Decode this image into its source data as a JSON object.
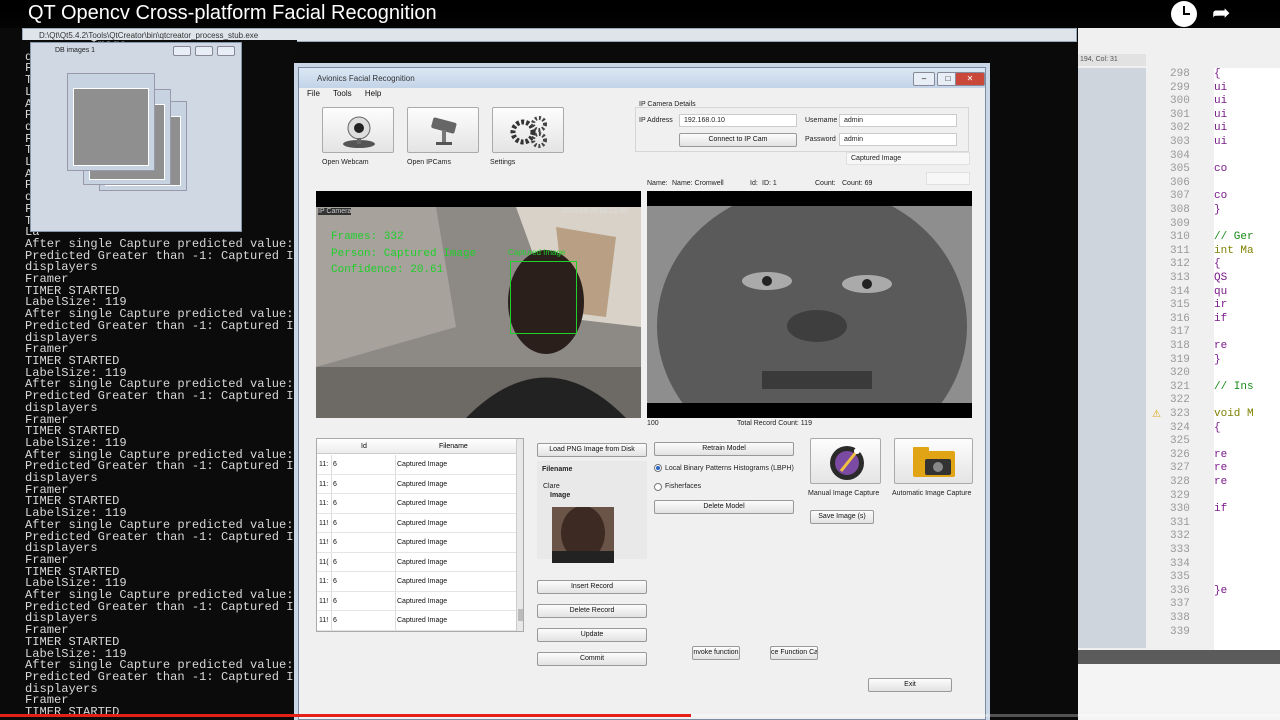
{
  "video": {
    "title": "QT Opencv Cross-platform Facial Recognition"
  },
  "console": {
    "path": "D:\\Qt\\Qt5.4.2\\Tools\\QtCreator\\bin\\qtcreator_process_stub.exe",
    "lines": [
      "",
      "         Image",
      "di",
      "Fr",
      "TI",
      "La",
      "Af           value: 114",
      "Pr          Captured Image",
      "di",
      "Fr",
      "TI",
      "La",
      "Af           value: 114",
      "Pr          Captured Image",
      "di",
      "Fr",
      "TI",
      "La",
      "After single Capture predicted value: 115",
      "Predicted Greater than -1: Captured Image",
      "displayers",
      "Framer",
      "TIMER STARTED",
      "LabelSize: 119",
      "After single Capture predicted value: 114",
      "Predicted Greater than -1: Captured Image",
      "displayers",
      "Framer",
      "TIMER STARTED",
      "LabelSize: 119",
      "After single Capture predicted value: 114",
      "Predicted Greater than -1: Captured Image",
      "displayers",
      "Framer",
      "TIMER STARTED",
      "LabelSize: 119",
      "After single Capture predicted value: 113",
      "Predicted Greater than -1: Captured Image",
      "displayers",
      "Framer",
      "TIMER STARTED",
      "LabelSize: 119",
      "After single Capture predicted value: 113",
      "Predicted Greater than -1: Captured Image",
      "displayers",
      "Framer",
      "TIMER STARTED",
      "LabelSize: 119",
      "After single Capture predicted value: 114",
      "Predicted Greater than -1: Captured Image",
      "displayers",
      "Framer",
      "TIMER STARTED",
      "LabelSize: 119",
      "After single Capture predicted value: 114",
      "Predicted Greater than -1: Captured Image",
      "displayers",
      "Framer",
      "TIMER STARTED"
    ]
  },
  "db_window": {
    "title": "DB images 1"
  },
  "app": {
    "title": "Avionics Facial Recognition",
    "menu": [
      "File",
      "Tools",
      "Help"
    ],
    "toolbar": {
      "webcam": "Open Webcam",
      "ipcam": "Open IPCams",
      "settings": "Settings"
    },
    "ip": {
      "group": "IP Camera Details",
      "address_label": "IP Address",
      "address": "192.168.0.10",
      "username_label": "Username",
      "username": "admin",
      "password_label": "Password",
      "password": "admin",
      "connect": "Connect to IP Cam",
      "captured": "Captured Image"
    },
    "info": {
      "name_label": "Name:",
      "name": "Name: Cromwell",
      "id_label": "Id:",
      "id": "ID: 1",
      "count_label": "Count:",
      "count": "Count: 69"
    },
    "cam_overlay": {
      "label": "IP Camera",
      "timestamp": "2015-09-23 06:12:30",
      "frames": "Frames: 332",
      "person": "Person: Captured Image",
      "confidence": "Confidence: 20.61",
      "box_label": "Captured Image"
    },
    "below": {
      "left_value": "100",
      "total": "Total Record Count: 119"
    },
    "table": {
      "headers": [
        "Id",
        "Filename"
      ],
      "rows": [
        {
          "no": "11:",
          "id": "6",
          "file": "Captured Image"
        },
        {
          "no": "11:",
          "id": "6",
          "file": "Captured Image"
        },
        {
          "no": "11:",
          "id": "6",
          "file": "Captured Image"
        },
        {
          "no": "11!",
          "id": "6",
          "file": "Captured Image"
        },
        {
          "no": "11!",
          "id": "6",
          "file": "Captured Image"
        },
        {
          "no": "11(",
          "id": "6",
          "file": "Captured Image"
        },
        {
          "no": "11:",
          "id": "6",
          "file": "Captured Image"
        },
        {
          "no": "11!",
          "id": "6",
          "file": "Captured Image"
        },
        {
          "no": "11!",
          "id": "6",
          "file": "Captured Image"
        }
      ]
    },
    "buttons": {
      "load": "Load PNG Image from Disk",
      "insert": "Insert Record",
      "delete": "Delete Record",
      "update": "Update",
      "commit": "Commit",
      "retrain": "Retrain Model",
      "delete_model": "Delete Model",
      "save": "Save Image (s)",
      "invoke1": "nvoke function",
      "invoke2": "ce Function Ca",
      "exit": "Exit"
    },
    "detail": {
      "filename_label": "Filename",
      "filename": "Clare",
      "image_label": "Image"
    },
    "radios": {
      "lbph": "Local Binary Patterns Histograms (LBPH)",
      "fisher": "Fisherfaces"
    },
    "captures": {
      "manual": "Manual Image Capture",
      "auto": "Automatic Image Capture"
    }
  },
  "editor": {
    "status": "194, Col: 31",
    "lines": [
      "298",
      "299",
      "300",
      "301",
      "302",
      "303",
      "304",
      "305",
      "306",
      "307",
      "308",
      "309",
      "310",
      "311",
      "312",
      "313",
      "314",
      "315",
      "316",
      "317",
      "318",
      "319",
      "320",
      "321",
      "322",
      "323",
      "324",
      "325",
      "326",
      "327",
      "328",
      "329",
      "330",
      "331",
      "332",
      "333",
      "334",
      "335",
      "336",
      "337",
      "338",
      "339"
    ],
    "code": [
      "{",
      "ui",
      "ui",
      "ui",
      "ui",
      "ui",
      "",
      "co",
      "",
      "co",
      "}",
      "",
      "// Ger",
      "int Ma",
      "{",
      "QS",
      "qu",
      "ir",
      "if",
      "",
      "re",
      "}",
      "",
      "// Ins",
      "",
      "void M",
      "{",
      "",
      "re",
      "re",
      "re",
      "",
      "if",
      "",
      "",
      "",
      "",
      "",
      "}e",
      "",
      "",
      ""
    ]
  },
  "colors": {
    "accent": "#c9483a",
    "progress": "#e52117"
  },
  "progress": {
    "value": 0.54
  }
}
